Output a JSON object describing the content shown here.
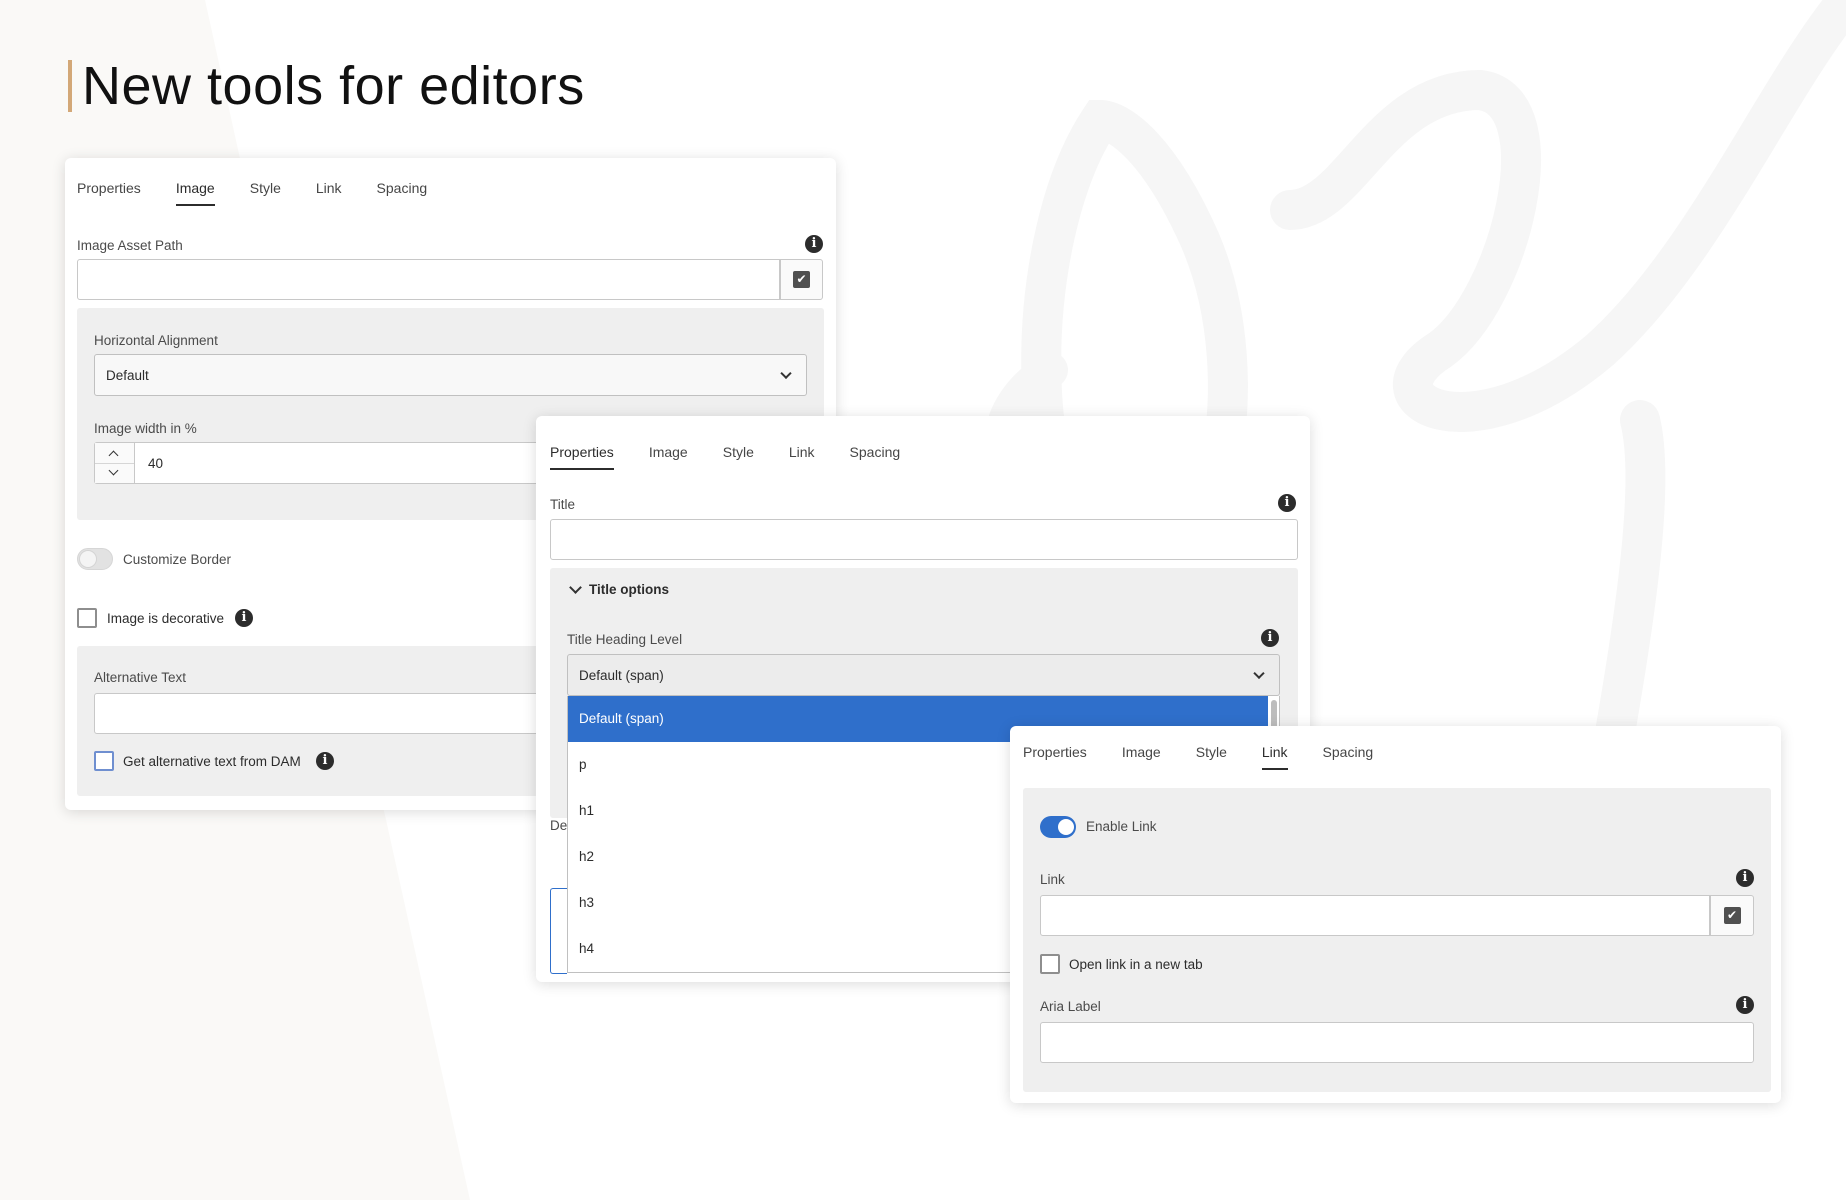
{
  "headline": "New tools for editors",
  "colors": {
    "accent_bar": "#d3a878",
    "selected_blue": "#2f6fcb"
  },
  "dialog_image": {
    "tabs": [
      "Properties",
      "Image",
      "Style",
      "Link",
      "Spacing"
    ],
    "active_tab": "Image",
    "asset_path_label": "Image Asset Path",
    "asset_path_value": "",
    "alignment_label": "Horizontal Alignment",
    "alignment_value": "Default",
    "width_label": "Image width in %",
    "width_value": "40",
    "customize_border_label": "Customize Border",
    "decorative_label": "Image is decorative",
    "alt_text_label": "Alternative Text",
    "alt_text_value": "",
    "alt_from_dam_label": "Get alternative text from DAM"
  },
  "dialog_properties": {
    "tabs": [
      "Properties",
      "Image",
      "Style",
      "Link",
      "Spacing"
    ],
    "active_tab": "Properties",
    "title_label": "Title",
    "title_value": "",
    "title_options_label": "Title options",
    "heading_level_label": "Title Heading Level",
    "heading_level_value": "Default (span)",
    "heading_options": [
      "Default (span)",
      "p",
      "h1",
      "h2",
      "h3",
      "h4"
    ],
    "hidden_label_fragment": "De"
  },
  "dialog_link": {
    "tabs": [
      "Properties",
      "Image",
      "Style",
      "Link",
      "Spacing"
    ],
    "active_tab": "Link",
    "enable_link_label": "Enable Link",
    "enable_link_on": true,
    "link_label": "Link",
    "link_value": "",
    "new_tab_label": "Open link in a new tab",
    "aria_label_label": "Aria Label",
    "aria_label_value": ""
  }
}
